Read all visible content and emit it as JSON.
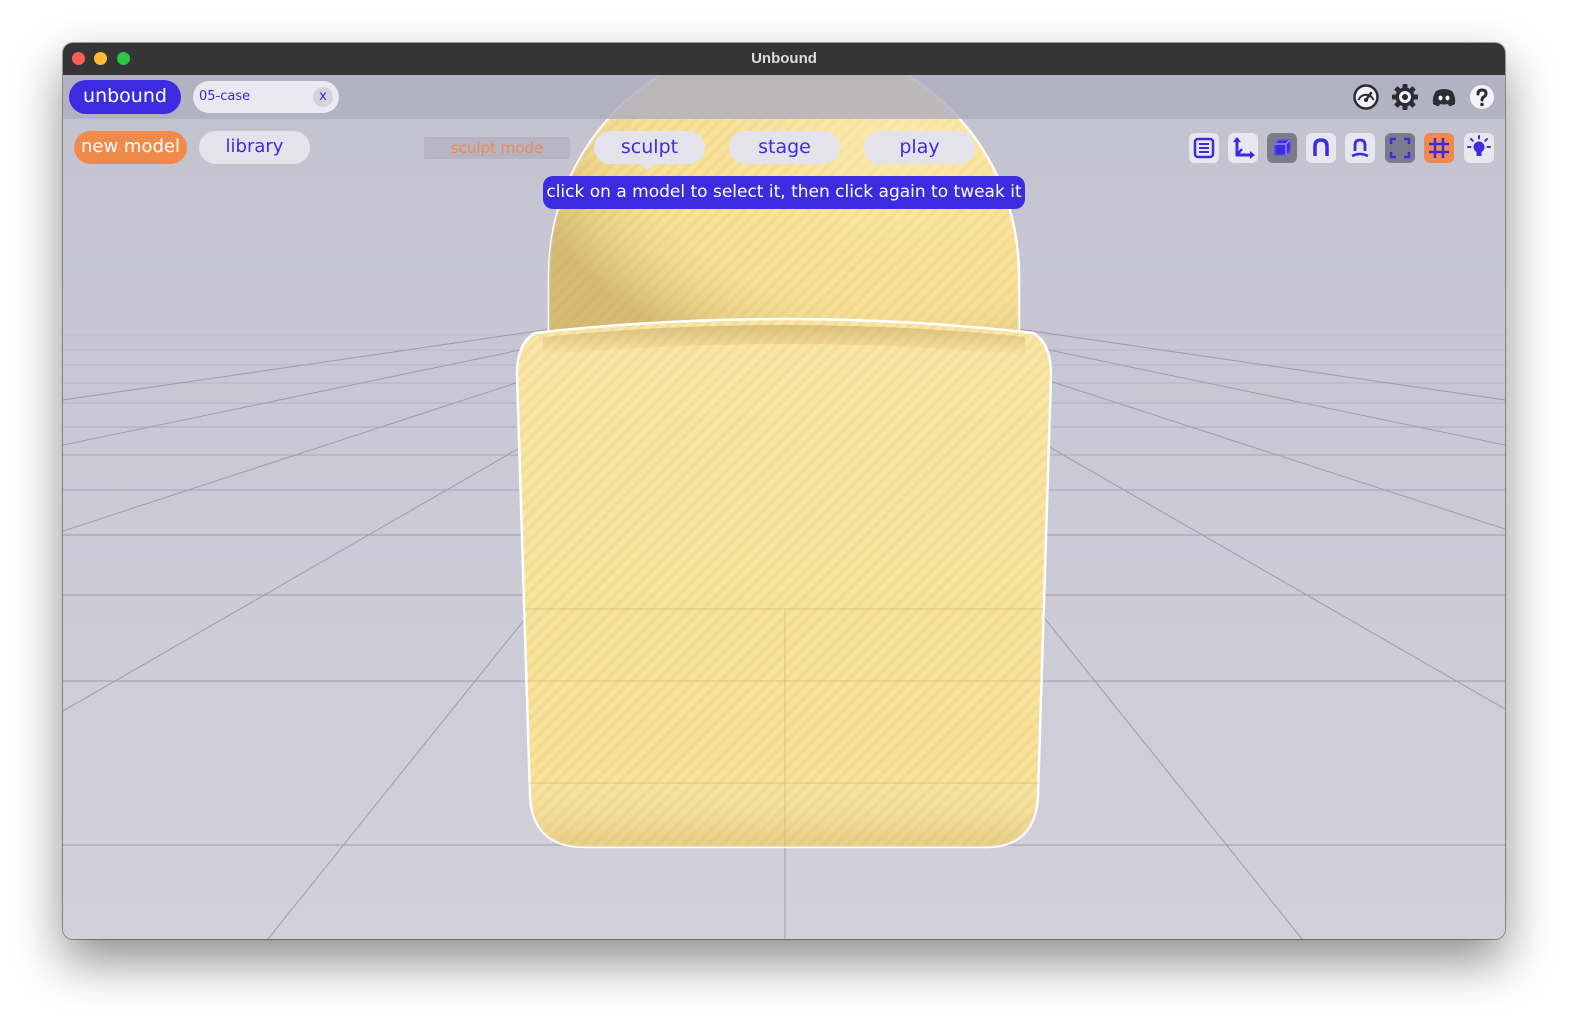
{
  "window": {
    "title": "Unbound"
  },
  "header": {
    "brand_label": "unbound",
    "file_tab": {
      "name": "05-case",
      "close_label": "x"
    },
    "icons": [
      "speedometer-icon",
      "gear-icon",
      "discord-icon",
      "help-icon"
    ]
  },
  "toolbar": {
    "new_model_label": "new model",
    "library_label": "library",
    "mode_label": "sculpt mode",
    "modes": [
      {
        "label": "sculpt",
        "selected": true
      },
      {
        "label": "stage",
        "selected": false
      },
      {
        "label": "play",
        "selected": false
      }
    ],
    "tools": [
      "list-icon",
      "axes-icon",
      "cube-icon",
      "magnet-icon",
      "person-magnet-icon",
      "fit-view-icon",
      "grid-icon",
      "light-icon"
    ]
  },
  "hint_text": "click on a model to select it, then click again to tweak it",
  "colors": {
    "accent": "#3d2be0",
    "orange": "#f08a4b",
    "model_fill": "#f8e29a",
    "background": "#cdccd8"
  }
}
